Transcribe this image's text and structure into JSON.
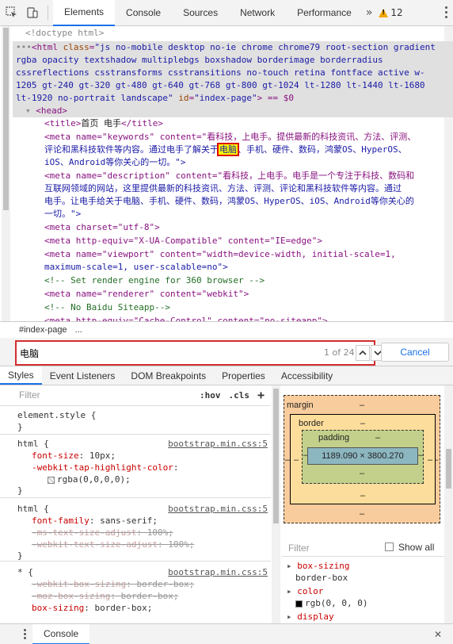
{
  "toolbar": {
    "tabs": [
      "Elements",
      "Console",
      "Sources",
      "Network",
      "Performance"
    ],
    "more": "»",
    "warnings": "12"
  },
  "tree": {
    "doctype": "<!doctype html>",
    "html_prefix": "<html ",
    "html_class_attr": "class",
    "html_class_l1": "\"js no-mobile desktop no-ie chrome chrome79 root-section gradient",
    "html_class_l2": "rgba opacity textshadow multiplebgs boxshadow borderimage borderradius",
    "html_class_l3": "cssreflections csstransforms csstransitions no-touch retina fontface active w-",
    "html_class_l4": "1205 gt-240 gt-320 gt-480 gt-640 gt-768 gt-800 gt-1024 lt-1280 lt-1440 lt-1680",
    "html_class_l5a": "lt-1920 no-portrait landscape\"",
    "html_id_attr": "id",
    "html_id_val": "\"index-page\"",
    "html_suffix": "> == $0",
    "head": "<head>",
    "title_open": "<title>",
    "title_text": "首页 电手",
    "title_close": "</title>",
    "meta_kw_l1a": "<meta name=\"keywords\" content=\"看科技，上电手。提供最新的科技资讯、方法、评测、",
    "meta_kw_l2a": "评论和黑科技软件等内容。通过电手了解关于",
    "meta_kw_hl": "电脑",
    "meta_kw_l2b": "、手机、硬件、数码，鸿蒙OS、HyperOS、",
    "meta_kw_l3": "iOS、Android等你关心的一切。\">",
    "meta_desc_l1": "<meta name=\"description\" content=\"看科技，上电手。电手是一个专注于科技、数码和",
    "meta_desc_l2": "互联网领域的网站，这里提供最新的科技资讯、方法、评测、评论和黑科技软件等内容。通过",
    "meta_desc_l3": "电手。让电手给关于电脑、手机、硬件、数码，鸿蒙OS、HyperOS、iOS、Android等你关心的",
    "meta_desc_l4": "一切。\">",
    "meta_charset": "<meta charset=\"utf-8\">",
    "meta_httpeq": "<meta http-equiv=\"X-UA-Compatible\" content=\"IE=edge\">",
    "meta_vp_l1": "<meta name=\"viewport\" content=\"width=device-width, initial-scale=1,",
    "meta_vp_l2": "maximum-scale=1, user-scalable=no\">",
    "comment1": "<!-- Set render engine for 360 browser -->",
    "meta_renderer": "<meta name=\"renderer\" content=\"webkit\">",
    "comment2": "<!-- No Baidu Siteapp-->",
    "meta_cache_partial": "<meta http-equiv=\"Cache-Control\" content=\"no-siteapp\">"
  },
  "breadcrumb": {
    "item": "#index-page",
    "more": "..."
  },
  "search": {
    "value": "电脑",
    "count": "1 of 24",
    "cancel": "Cancel"
  },
  "styles_tabs": [
    "Styles",
    "Event Listeners",
    "DOM Breakpoints",
    "Properties",
    "Accessibility"
  ],
  "styles": {
    "filter_placeholder": "Filter",
    "hov": ":hov",
    "cls": ".cls",
    "plus": "+",
    "element_style": "element.style {",
    "close": "}",
    "rules": [
      {
        "selector": "html {",
        "source": "bootstrap.min.css:5",
        "props": [
          {
            "name": "font-size",
            "value": "10px;",
            "strike": false
          },
          {
            "name": "-webkit-tap-highlight-color",
            "value": "",
            "strike": false
          },
          {
            "name": "",
            "value": "rgba(0,0,0,0);",
            "strike": false,
            "swatch": true
          }
        ]
      },
      {
        "selector": "html {",
        "source": "bootstrap.min.css:5",
        "props": [
          {
            "name": "font-family",
            "value": "sans-serif;",
            "strike": false
          },
          {
            "name": "-ms-text-size-adjust",
            "value": "100%;",
            "strike": true
          },
          {
            "name": "-webkit-text-size-adjust",
            "value": "100%;",
            "strike": true
          }
        ]
      },
      {
        "selector": "* {",
        "source": "bootstrap.min.css:5",
        "props": [
          {
            "name": "-webkit-box-sizing",
            "value": "border-box;",
            "strike": true
          },
          {
            "name": "-moz-box-sizing",
            "value": "border-box;",
            "strike": true
          },
          {
            "name": "box-sizing",
            "value": "border-box;",
            "strike": false
          }
        ]
      }
    ]
  },
  "boxmodel": {
    "margin": "margin",
    "border": "border",
    "padding": "padding",
    "dash": "–",
    "content": "1189.090 × 3800.270"
  },
  "computed": {
    "filter_placeholder": "Filter",
    "show_all": "Show all",
    "items": [
      {
        "name": "box-sizing",
        "value": "border-box"
      },
      {
        "name": "color",
        "value": "rgb(0, 0, 0)"
      },
      {
        "name": "display",
        "value": ""
      }
    ]
  },
  "drawer": {
    "tab": "Console"
  },
  "colors": {
    "accent": "#1a73e8",
    "highlight_outline": "#d32f2f",
    "warning": "#f2a600"
  }
}
